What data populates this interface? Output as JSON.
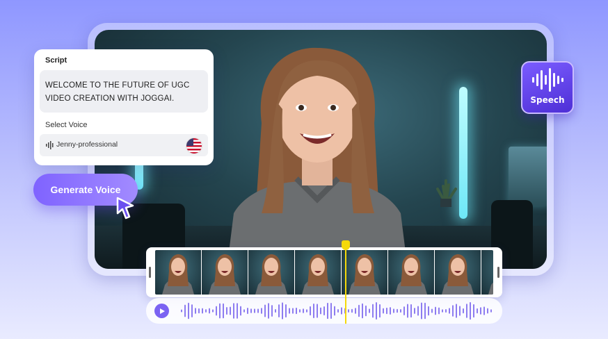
{
  "script_card": {
    "script_label": "Script",
    "script_text": "WELCOME TO THE FUTURE OF UGC VIDEO CREATION WITH JOGGAI.",
    "voice_label": "Select Voice",
    "voice_name": "Jenny-professional",
    "voice_flag": "us-flag-icon"
  },
  "generate_button": {
    "label": "Generate Voice"
  },
  "speech_badge": {
    "label": "Speech",
    "icon": "sound-wave-icon"
  },
  "timeline": {
    "frame_count": 8
  },
  "audio": {
    "play_icon": "play-icon"
  },
  "colors": {
    "accent": "#7b63f2",
    "playhead": "#f5d90a",
    "background_top": "#8f97ff"
  }
}
